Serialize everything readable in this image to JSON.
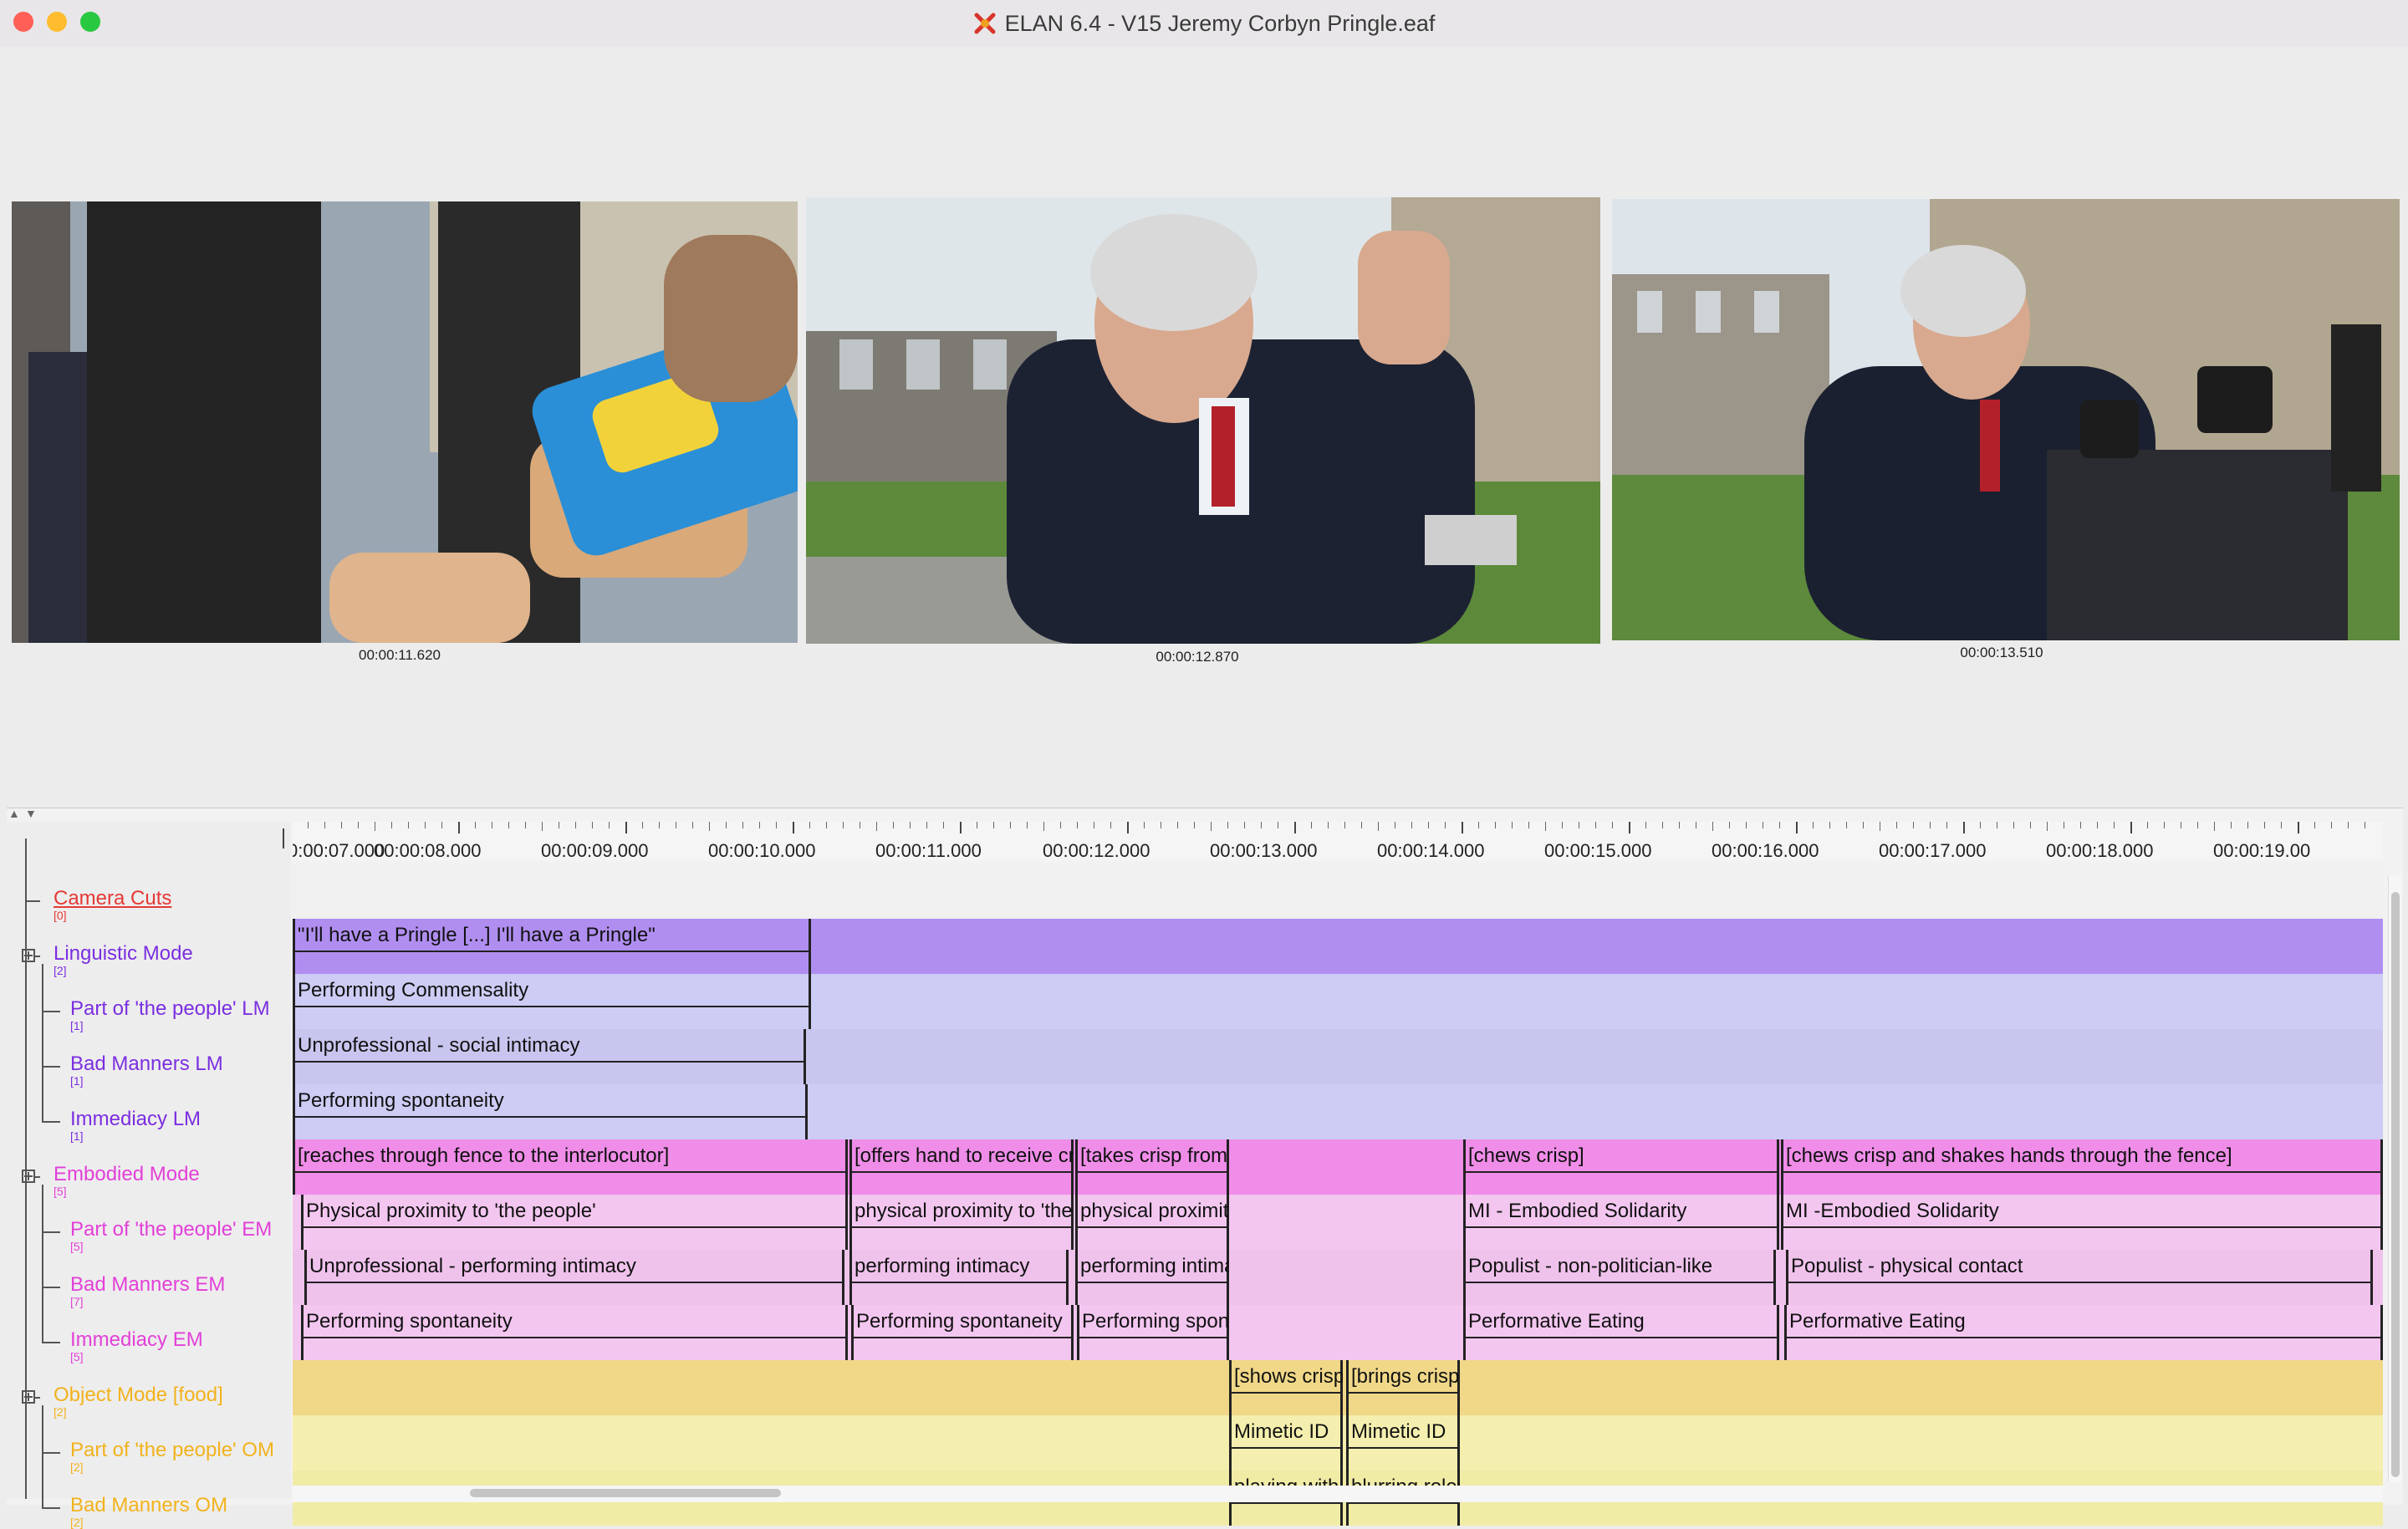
{
  "window": {
    "title": "ELAN 6.4 - V15 Jeremy Corbyn Pringle.eaf",
    "app_icon": "elan-icon",
    "traffic_lights": [
      "close",
      "minimize",
      "maximize"
    ]
  },
  "videos": [
    {
      "timestamp": "00:00:11.620"
    },
    {
      "timestamp": "00:00:12.870"
    },
    {
      "timestamp": "00:00:13.510"
    }
  ],
  "ruler": {
    "labels": [
      "0:00:07.000",
      "00:00:08.000",
      "00:00:09.000",
      "00:00:10.000",
      "00:00:11.000",
      "00:00:12.000",
      "00:00:13.000",
      "00:00:14.000",
      "00:00:15.000",
      "00:00:16.000",
      "00:00:17.000",
      "00:00:18.000",
      "00:00:19.00"
    ]
  },
  "tiers": [
    {
      "name": "Camera Cuts",
      "count": "[0]",
      "color": "#e53935",
      "underline": true
    },
    {
      "name": "Linguistic Mode",
      "count": "[2]",
      "color": "#7b2ee0"
    },
    {
      "name": "Part of 'the people' LM",
      "count": "[1]",
      "color": "#7b2ee0"
    },
    {
      "name": "Bad Manners LM",
      "count": "[1]",
      "color": "#7b2ee0"
    },
    {
      "name": "Immediacy LM",
      "count": "[1]",
      "color": "#7b2ee0"
    },
    {
      "name": "Embodied Mode",
      "count": "[5]",
      "color": "#e33fd8"
    },
    {
      "name": "Part of 'the people' EM",
      "count": "[5]",
      "color": "#e33fd8"
    },
    {
      "name": "Bad Manners EM",
      "count": "[7]",
      "color": "#e33fd8"
    },
    {
      "name": "Immediacy EM",
      "count": "[5]",
      "color": "#e33fd8"
    },
    {
      "name": "Object Mode [food]",
      "count": "[2]",
      "color": "#f2b21c"
    },
    {
      "name": "Part of 'the people' OM",
      "count": "[2]",
      "color": "#f2b21c"
    },
    {
      "name": "Bad Manners OM",
      "count": "[2]",
      "color": "#f2b21c"
    }
  ],
  "rows": [
    {
      "bg": "#f0f0f0",
      "annotations": []
    },
    {
      "bg": "#b08ef0",
      "annotations": [
        {
          "text": "\"I'll have a Pringle [...] I'll have a Pringle\"",
          "start": 7.0,
          "end": 10.1
        }
      ]
    },
    {
      "bg": "#ccccf4",
      "annotations": [
        {
          "text": "Performing Commensality",
          "start": 7.0,
          "end": 10.1
        }
      ]
    },
    {
      "bg": "#c8c6ee",
      "annotations": [
        {
          "text": "Unprofessional - social intimacy",
          "start": 7.0,
          "end": 10.07
        }
      ]
    },
    {
      "bg": "#ccccf4",
      "annotations": [
        {
          "text": "Performing spontaneity",
          "start": 7.0,
          "end": 10.08
        }
      ]
    },
    {
      "bg": "#ef8de8",
      "annotations": [
        {
          "text": "[reaches through fence to the interlocutor]",
          "start": 7.0,
          "end": 10.32
        },
        {
          "text": "[offers hand to receive crisp]",
          "start": 10.33,
          "end": 11.67
        },
        {
          "text": "[takes crisp from tube]",
          "start": 11.68,
          "end": 12.6
        },
        {
          "text": "[chews crisp]",
          "start": 14.0,
          "end": 15.89
        },
        {
          "text": "[chews crisp and shakes hands through the fence]",
          "start": 15.9,
          "end": 19.5
        }
      ]
    },
    {
      "bg": "#f3c6f0",
      "annotations": [
        {
          "text": "Physical proximity to 'the people'",
          "start": 7.05,
          "end": 10.32
        },
        {
          "text": "physical proximity to 'the people'",
          "start": 10.33,
          "end": 11.67
        },
        {
          "text": "physical proximity",
          "start": 11.68,
          "end": 12.6
        },
        {
          "text": "MI - Embodied Solidarity",
          "start": 14.0,
          "end": 15.89
        },
        {
          "text": "MI -Embodied Solidarity",
          "start": 15.9,
          "end": 19.5
        }
      ]
    },
    {
      "bg": "#efc2ec",
      "annotations": [
        {
          "text": "Unprofessional  - performing intimacy",
          "start": 7.07,
          "end": 10.3
        },
        {
          "text": "performing intimacy",
          "start": 10.33,
          "end": 11.64
        },
        {
          "text": "performing intimacy",
          "start": 11.68,
          "end": 12.6
        },
        {
          "text": "Populist - non-politician-like",
          "start": 14.0,
          "end": 15.87
        },
        {
          "text": "Populist - physical contact",
          "start": 15.93,
          "end": 19.44
        }
      ]
    },
    {
      "bg": "#f3c6f0",
      "annotations": [
        {
          "text": "Performing spontaneity",
          "start": 7.05,
          "end": 10.32
        },
        {
          "text": "Performing spontaneity",
          "start": 10.34,
          "end": 11.67
        },
        {
          "text": "Performing spontaneity",
          "start": 11.69,
          "end": 12.6
        },
        {
          "text": "Performative Eating",
          "start": 14.0,
          "end": 15.89
        },
        {
          "text": "Performative Eating",
          "start": 15.92,
          "end": 19.5
        }
      ]
    },
    {
      "bg": "#f0d888",
      "annotations": [
        {
          "text": "[shows crisp]",
          "start": 12.6,
          "end": 13.28
        },
        {
          "text": "[brings crisp to mouth]",
          "start": 13.3,
          "end": 13.98
        }
      ]
    },
    {
      "bg": "#f4efae",
      "annotations": [
        {
          "text": "Mimetic ID",
          "start": 12.6,
          "end": 13.28
        },
        {
          "text": "Mimetic ID",
          "start": 13.3,
          "end": 13.98
        }
      ]
    },
    {
      "bg": "#f0eca6",
      "annotations": [
        {
          "text": "playing with food",
          "start": 12.6,
          "end": 13.28
        },
        {
          "text": "blurring roles",
          "start": 13.3,
          "end": 13.98
        }
      ]
    }
  ]
}
